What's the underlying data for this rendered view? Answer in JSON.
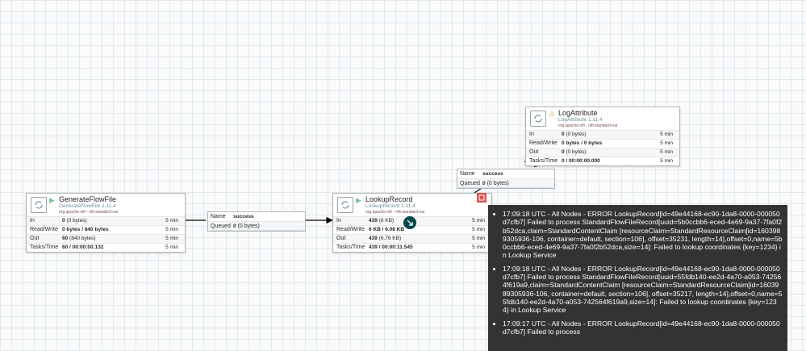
{
  "processors": {
    "generate": {
      "name": "GenerateFlowFile",
      "type": "GenerateFlowFile 1.11.4",
      "bundle": "org.apache.nifi - nifi-standard-nar",
      "status_icon": "play-icon",
      "rows": [
        {
          "label": "In",
          "value": "0",
          "sub": "(0 bytes)",
          "time": "5 min"
        },
        {
          "label": "Read/Write",
          "value": "0 bytes / 840 bytes",
          "sub": "",
          "time": "5 min"
        },
        {
          "label": "Out",
          "value": "60",
          "sub": "(840 bytes)",
          "time": "5 min"
        },
        {
          "label": "Tasks/Time",
          "value": "60 / 00:00:00.132",
          "sub": "",
          "time": "5 min"
        }
      ]
    },
    "lookup": {
      "name": "LookupRecord",
      "type": "LookupRecord 1.11.4",
      "bundle": "org.apache.nifi - nifi-standard-nar",
      "status_icon": "play-icon",
      "rows": [
        {
          "label": "In",
          "value": "439",
          "sub": "(6 KB)",
          "time": "5 min"
        },
        {
          "label": "Read/Write",
          "value": "6 KB / 6.08 KB",
          "sub": "",
          "time": "5 min"
        },
        {
          "label": "Out",
          "value": "439",
          "sub": "(6.76 KB)",
          "time": "5 min"
        },
        {
          "label": "Tasks/Time",
          "value": "439 / 00:00:11.545",
          "sub": "",
          "time": "5 min"
        }
      ]
    },
    "log": {
      "name": "LogAttribute",
      "type": "LogAttribute 1.11.4",
      "bundle": "org.apache.nifi - nifi-standard-nar",
      "status_icon": "warning-icon",
      "rows": [
        {
          "label": "In",
          "value": "0",
          "sub": "(0 bytes)",
          "time": "5 min"
        },
        {
          "label": "Read/Write",
          "value": "0 bytes / 0 bytes",
          "sub": "",
          "time": "5 min"
        },
        {
          "label": "Out",
          "value": "0",
          "sub": "(0 bytes)",
          "time": "5 min"
        },
        {
          "label": "Tasks/Time",
          "value": "0 / 00:00:00.000",
          "sub": "",
          "time": "5 min"
        }
      ]
    }
  },
  "connections": {
    "c1": {
      "name_label": "Name",
      "name_value": "success",
      "queued_label": "Queued",
      "queued_value": "0",
      "queued_sub": "(0 bytes)"
    },
    "c2": {
      "name_label": "Name",
      "name_value": "success",
      "queued_label": "Queued",
      "queued_value": "0",
      "queued_sub": "(0 bytes)"
    }
  },
  "bulletins": [
    "17:09:18 UTC - All Nodes - ERROR LookupRecord[id=49e44168-ec90-1da8-0000-000050d7cfb7] Failed to process StandardFlowFileRecord[uuid=5b0ccbb6-eced-4e69-9a37-7fa0f2b52dca,claim=StandardContentClaim [resourceClaim=StandardResourceClaim[id=1603989305936-106, container=default, section=106], offset=35231, length=14],offset=0,name=5b0ccbb6-eced-4e69-9a37-7fa0f2b52dca,size=14]: Failed to lookup coordinates {key=1234} in Lookup Service",
    "17:09:18 UTC - All Nodes - ERROR LookupRecord[id=49e44168-ec90-1da8-0000-000050d7cfb7] Failed to process StandardFlowFileRecord[uuid=55fdb140-ee2d-4a70-a053-742564f619a9,claim=StandardContentClaim [resourceClaim=StandardResourceClaim[id=1603989305936-106, container=default, section=106], offset=35217, length=14],offset=0,name=55fdb140-ee2d-4a70-a053-742564f619a9,size=14]: Failed to lookup coordinates {key=1234} in Lookup Service",
    "17:09:17 UTC - All Nodes - ERROR LookupRecord[id=49e44168-ec90-1da8-0000-000050d7cfb7] Failed to process"
  ],
  "colors": {
    "play": "#7dc7a0",
    "warning": "#cf9f5d",
    "bulletin": "#d9534f",
    "tooltip_bg": "#333333"
  }
}
